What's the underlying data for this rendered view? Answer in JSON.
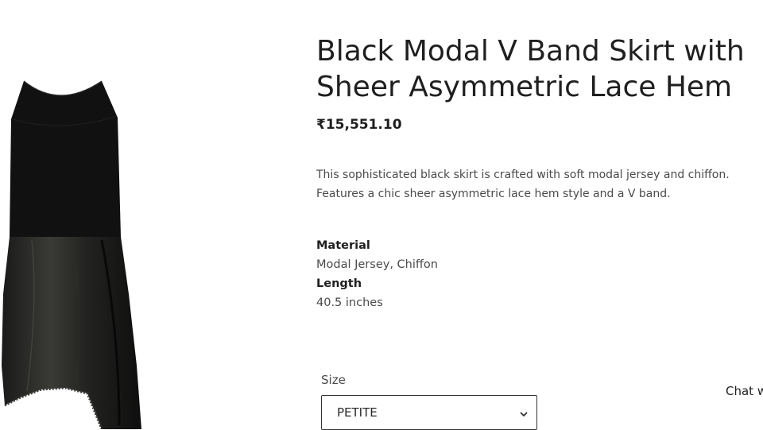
{
  "product": {
    "image_alt": "Black Modal V Band Skirt with Sheer Asymmetric Lace Hem",
    "title_line1": "Black Modal V Band Skirt with",
    "title_line2": "Sheer Asymmetric Lace Hem",
    "price": "₹15,551.10",
    "description": "This sophisticated black skirt is crafted with soft modal jersey and chiffon. Features a chic sheer asymmetric lace hem style and a V band.",
    "specs": [
      {
        "label": "Material",
        "value": "Modal Jersey, Chiffon"
      },
      {
        "label": "Length",
        "value": "40.5 inches"
      }
    ]
  },
  "options": {
    "size_label": "Size",
    "size_selected": "PETITE"
  },
  "chat": {
    "label": "Chat w"
  },
  "colors": {
    "text_dark": "#1f1f1f",
    "text_body": "#4a4a4a",
    "skirt_black": "#111111",
    "border": "#333333"
  },
  "icons": {
    "select_chevron": "chevron-down-icon"
  }
}
